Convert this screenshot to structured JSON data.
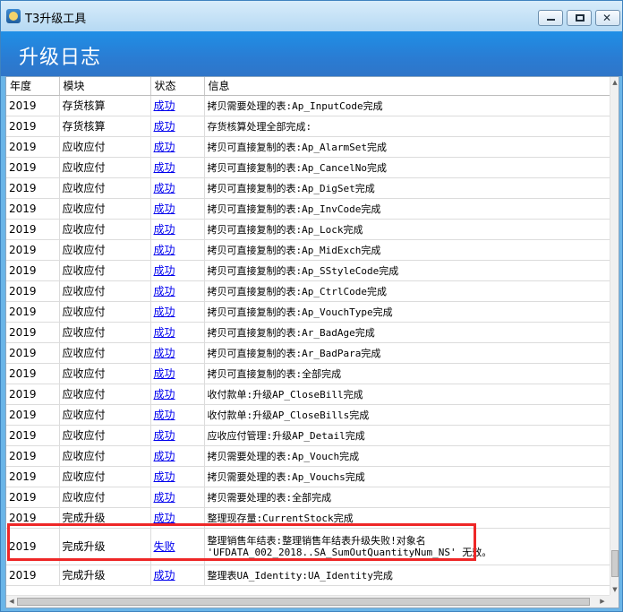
{
  "window": {
    "title": "T3升级工具"
  },
  "banner": {
    "title": "升级日志"
  },
  "table": {
    "headers": [
      "年度",
      "模块",
      "状态",
      "信息"
    ],
    "rows": [
      {
        "year": "2019",
        "module": "存货核算",
        "status": "成功",
        "info": "拷贝需要处理的表:Ap_InputCode完成"
      },
      {
        "year": "2019",
        "module": "存货核算",
        "status": "成功",
        "info": "存货核算处理全部完成:"
      },
      {
        "year": "2019",
        "module": "应收应付",
        "status": "成功",
        "info": "拷贝可直接复制的表:Ap_AlarmSet完成"
      },
      {
        "year": "2019",
        "module": "应收应付",
        "status": "成功",
        "info": "拷贝可直接复制的表:Ap_CancelNo完成"
      },
      {
        "year": "2019",
        "module": "应收应付",
        "status": "成功",
        "info": "拷贝可直接复制的表:Ap_DigSet完成"
      },
      {
        "year": "2019",
        "module": "应收应付",
        "status": "成功",
        "info": "拷贝可直接复制的表:Ap_InvCode完成"
      },
      {
        "year": "2019",
        "module": "应收应付",
        "status": "成功",
        "info": "拷贝可直接复制的表:Ap_Lock完成"
      },
      {
        "year": "2019",
        "module": "应收应付",
        "status": "成功",
        "info": "拷贝可直接复制的表:Ap_MidExch完成"
      },
      {
        "year": "2019",
        "module": "应收应付",
        "status": "成功",
        "info": "拷贝可直接复制的表:Ap_SStyleCode完成"
      },
      {
        "year": "2019",
        "module": "应收应付",
        "status": "成功",
        "info": "拷贝可直接复制的表:Ap_CtrlCode完成"
      },
      {
        "year": "2019",
        "module": "应收应付",
        "status": "成功",
        "info": "拷贝可直接复制的表:Ap_VouchType完成"
      },
      {
        "year": "2019",
        "module": "应收应付",
        "status": "成功",
        "info": "拷贝可直接复制的表:Ar_BadAge完成"
      },
      {
        "year": "2019",
        "module": "应收应付",
        "status": "成功",
        "info": "拷贝可直接复制的表:Ar_BadPara完成"
      },
      {
        "year": "2019",
        "module": "应收应付",
        "status": "成功",
        "info": "拷贝可直接复制的表:全部完成"
      },
      {
        "year": "2019",
        "module": "应收应付",
        "status": "成功",
        "info": "收付款单:升级AP_CloseBill完成"
      },
      {
        "year": "2019",
        "module": "应收应付",
        "status": "成功",
        "info": "收付款单:升级AP_CloseBills完成"
      },
      {
        "year": "2019",
        "module": "应收应付",
        "status": "成功",
        "info": "应收应付管理:升级AP_Detail完成"
      },
      {
        "year": "2019",
        "module": "应收应付",
        "status": "成功",
        "info": "拷贝需要处理的表:Ap_Vouch完成"
      },
      {
        "year": "2019",
        "module": "应收应付",
        "status": "成功",
        "info": "拷贝需要处理的表:Ap_Vouchs完成"
      },
      {
        "year": "2019",
        "module": "应收应付",
        "status": "成功",
        "info": "拷贝需要处理的表:全部完成"
      },
      {
        "year": "2019",
        "module": "完成升级",
        "status": "成功",
        "info": "整理现存量:CurrentStock完成"
      },
      {
        "year": "2019",
        "module": "完成升级",
        "status": "失败",
        "info": "整理销售年结表:整理销售年结表升级失败!对象名 'UFDATA_002_2018..SA_SumOutQuantityNum_NS' 无效。"
      },
      {
        "year": "2019",
        "module": "完成升级",
        "status": "成功",
        "info": "整理表UA_Identity:UA_Identity完成"
      }
    ]
  },
  "colors": {
    "banner": "#2a7cd3",
    "highlight_border": "#ee2727",
    "link": "#0000ee"
  }
}
